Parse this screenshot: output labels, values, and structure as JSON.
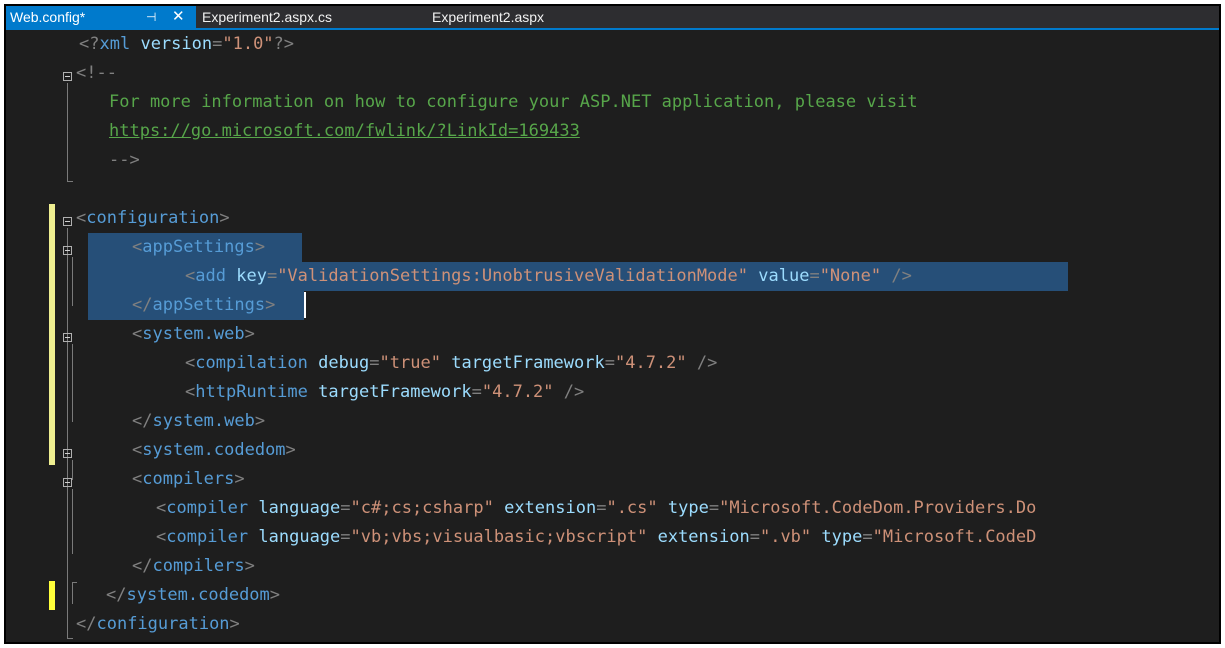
{
  "tabs": [
    {
      "label": "Web.config*",
      "active": true
    },
    {
      "label": "Experiment2.aspx.cs",
      "active": false
    },
    {
      "label": "Experiment2.aspx",
      "active": false
    }
  ],
  "tab_icons": {
    "pin": "pin-icon",
    "close": "close-icon"
  },
  "code": {
    "l1": {
      "p1": "<?",
      "p2": "xml",
      "p3": " ",
      "p4": "version",
      "p5": "=",
      "p6": "\"1.0\"",
      "p7": "?>"
    },
    "l2": {
      "p1": "<!--"
    },
    "l3": {
      "p1": "For more information on how to configure your ASP.NET application, please visit"
    },
    "l4": {
      "p1": "https://go.microsoft.com/fwlink/?LinkId=169433"
    },
    "l5": {
      "p1": "-->"
    },
    "l6": {
      "p1": "<",
      "p2": "configuration",
      "p3": ">"
    },
    "l7": {
      "p1": "<",
      "p2": "appSettings",
      "p3": ">"
    },
    "l8": {
      "p1": "<",
      "p2": "add",
      "p3": " ",
      "p4": "key",
      "p5": "=",
      "p6": "\"ValidationSettings:UnobtrusiveValidationMode\"",
      "p7": " ",
      "p8": "value",
      "p9": "=",
      "p10": "\"None\"",
      "p11": " />"
    },
    "l9": {
      "p1": "</",
      "p2": "appSettings",
      "p3": ">"
    },
    "l10": {
      "p1": "<",
      "p2": "system.web",
      "p3": ">"
    },
    "l11": {
      "p1": "<",
      "p2": "compilation",
      "p3": " ",
      "p4": "debug",
      "p5": "=",
      "p6": "\"true\"",
      "p7": " ",
      "p8": "targetFramework",
      "p9": "=",
      "p10": "\"4.7.2\"",
      "p11": " />"
    },
    "l12": {
      "p1": "<",
      "p2": "httpRuntime",
      "p3": " ",
      "p4": "targetFramework",
      "p5": "=",
      "p6": "\"4.7.2\"",
      "p7": " />"
    },
    "l13": {
      "p1": "</",
      "p2": "system.web",
      "p3": ">"
    },
    "l14": {
      "p1": "<",
      "p2": "system.codedom",
      "p3": ">"
    },
    "l15": {
      "p1": "<",
      "p2": "compilers",
      "p3": ">"
    },
    "l16": {
      "p1": "<",
      "p2": "compiler",
      "p3": " ",
      "p4": "language",
      "p5": "=",
      "p6": "\"c#;cs;csharp\"",
      "p7": " ",
      "p8": "extension",
      "p9": "=",
      "p10": "\".cs\"",
      "p11": " ",
      "p12": "type",
      "p13": "=",
      "p14": "\"Microsoft.CodeDom.Providers.Do"
    },
    "l17": {
      "p1": "<",
      "p2": "compiler",
      "p3": " ",
      "p4": "language",
      "p5": "=",
      "p6": "\"vb;vbs;visualbasic;vbscript\"",
      "p7": " ",
      "p8": "extension",
      "p9": "=",
      "p10": "\".vb\"",
      "p11": " ",
      "p12": "type",
      "p13": "=",
      "p14": "\"Microsoft.CodeD"
    },
    "l18": {
      "p1": "</",
      "p2": "compilers",
      "p3": ">"
    },
    "l19": {
      "p1": "</",
      "p2": "system.codedom",
      "p3": ">"
    },
    "l20": {
      "p1": "</",
      "p2": "configuration",
      "p3": ">"
    }
  },
  "colors": {
    "editor_bg": "#1e1e1e",
    "tab_active": "#007acc",
    "tag_delimiter": "#808080",
    "tag_name": "#569cd6",
    "attribute": "#9cdcfe",
    "string": "#ce9178",
    "comment": "#57a64a",
    "selection": "#264f78",
    "change_marker": "#efef91"
  }
}
